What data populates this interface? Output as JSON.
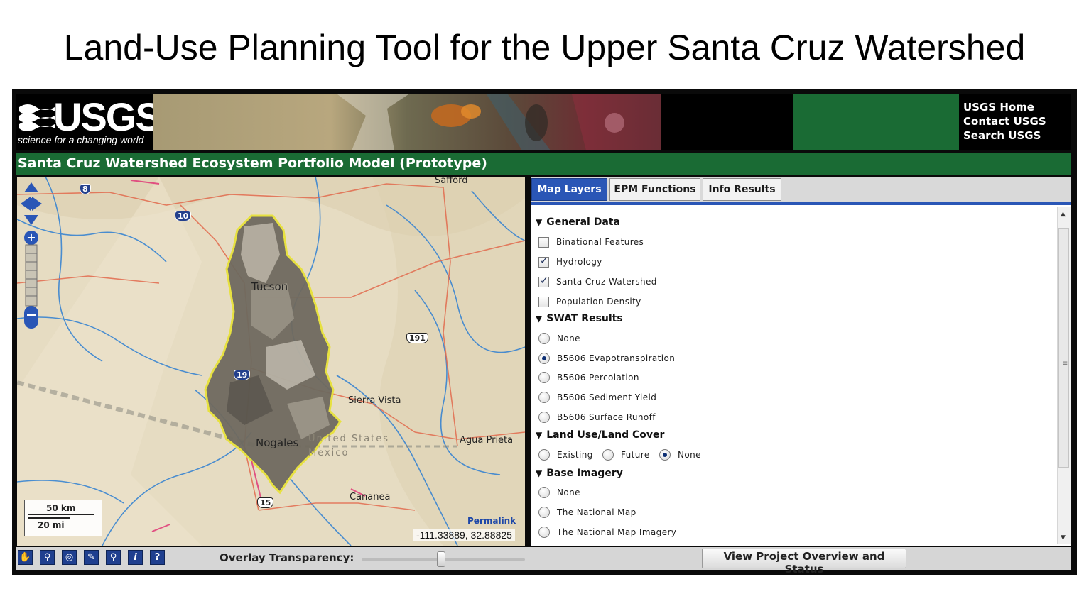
{
  "slide": {
    "title": "Land-Use Planning Tool for the Upper Santa Cruz Watershed"
  },
  "header": {
    "logo_word": "USGS",
    "logo_tagline": "science for a changing world",
    "links": [
      "USGS Home",
      "Contact USGS",
      "Search USGS"
    ]
  },
  "app": {
    "title": "Santa Cruz Watershed Ecosystem Portfolio Model (Prototype)"
  },
  "tabs": [
    {
      "label": "Map Layers",
      "active": true
    },
    {
      "label": "EPM Functions",
      "active": false
    },
    {
      "label": "Info Results",
      "active": false
    }
  ],
  "layers": {
    "general": {
      "title": "General Data",
      "items": [
        {
          "label": "Binational Features",
          "checked": false
        },
        {
          "label": "Hydrology",
          "checked": true
        },
        {
          "label": "Santa Cruz Watershed",
          "checked": true
        },
        {
          "label": "Population Density",
          "checked": false
        }
      ]
    },
    "swat": {
      "title": "SWAT Results",
      "items": [
        {
          "label": "None",
          "selected": false
        },
        {
          "label": "B5606 Evapotranspiration",
          "selected": true
        },
        {
          "label": "B5606 Percolation",
          "selected": false
        },
        {
          "label": "B5606 Sediment Yield",
          "selected": false
        },
        {
          "label": "B5606 Surface Runoff",
          "selected": false
        }
      ]
    },
    "landuse": {
      "title": "Land Use/Land Cover",
      "items": [
        {
          "label": "Existing",
          "selected": false
        },
        {
          "label": "Future",
          "selected": false
        },
        {
          "label": "None",
          "selected": true
        }
      ]
    },
    "imagery": {
      "title": "Base Imagery",
      "items": [
        {
          "label": "None",
          "selected": false
        },
        {
          "label": "The National Map",
          "selected": false
        },
        {
          "label": "The National Map Imagery",
          "selected": false
        }
      ]
    }
  },
  "map": {
    "places": [
      "Safford",
      "Tucson",
      "Sierra Vista",
      "Nogales",
      "United States",
      "Mexico",
      "Agua Prieta",
      "Cananea"
    ],
    "shields": [
      "8",
      "10",
      "191",
      "19",
      "15"
    ],
    "scale_km": "50 km",
    "scale_mi": "20 mi",
    "permalink": "Permalink",
    "coordinates": "-111.33889, 32.88825"
  },
  "bottom": {
    "tools": [
      "pan-hand-icon",
      "zoom-in-icon",
      "globe-icon",
      "identify-icon",
      "zoom-out-icon",
      "info-icon",
      "help-icon"
    ],
    "overlay_label": "Overlay Transparency:",
    "overlay_value": 0.5,
    "project_button": "View Project Overview and Status"
  },
  "colors": {
    "usgs_green": "#1a6b34",
    "tab_blue": "#2a56b6",
    "watershed_outline": "#e8e23a"
  }
}
